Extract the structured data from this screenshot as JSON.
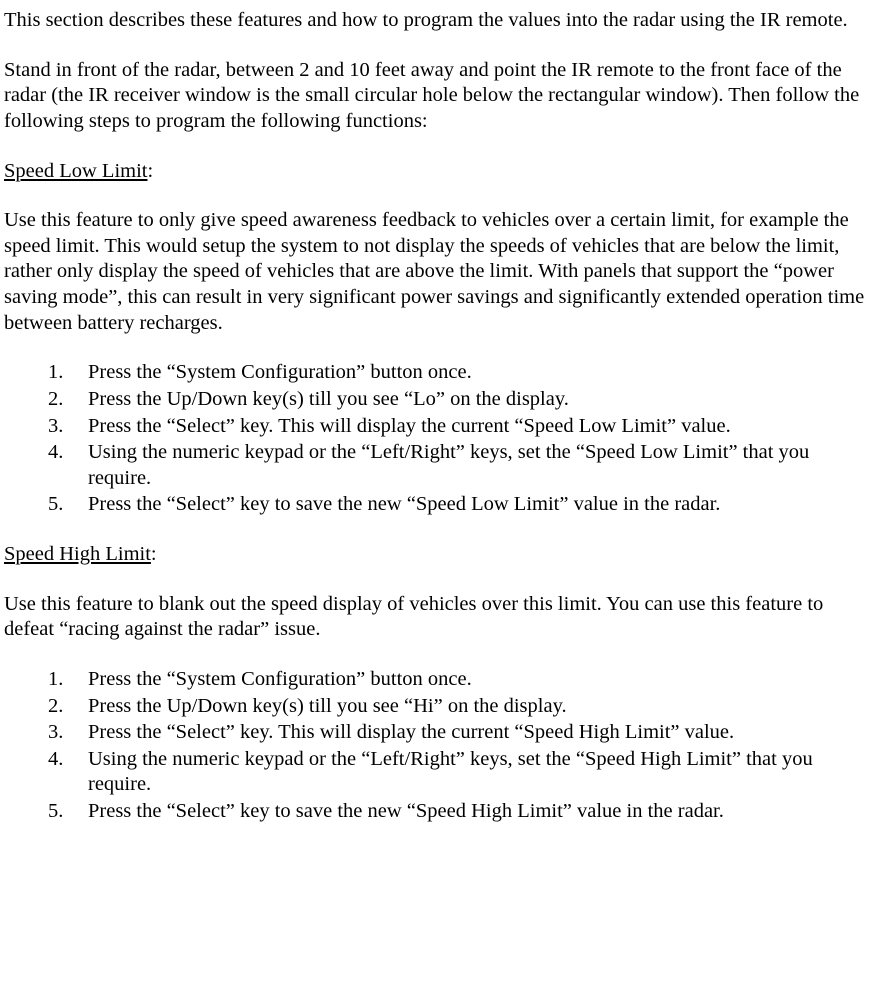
{
  "intro1": "This section describes these features and how to program the values into the radar using the IR remote.",
  "intro2": "Stand in front of the radar, between 2 and 10 feet away and point the IR remote to the front face of the radar (the IR receiver window is the small circular hole below the rectangular window). Then follow the following steps to program the following functions:",
  "speedLow": {
    "heading": "Speed Low Limit",
    "colon": ":",
    "desc": "Use this feature to only give speed awareness feedback to vehicles over a certain limit, for example the speed limit. This would setup the system to not display the speeds of vehicles that are below the limit, rather only display the speed of vehicles that are above the limit. With panels that support the “power saving mode”, this can result in very significant power savings and significantly extended operation time between battery recharges.",
    "steps": [
      "Press the “System Configuration” button once.",
      "Press the Up/Down key(s) till you see “Lo” on the display.",
      "Press the “Select” key. This will display the current “Speed Low Limit” value.",
      "Using the numeric keypad or the “Left/Right” keys, set the “Speed  Low Limit” that you require.",
      "Press the “Select” key to save the new “Speed Low Limit” value in the radar."
    ]
  },
  "speedHigh": {
    "heading": "Speed High Limit",
    "colon": ":",
    "desc": "Use this feature to blank out the speed display of vehicles over this limit. You can use this feature to defeat “racing against the radar” issue.",
    "steps": [
      "Press the “System Configuration” button once.",
      "Press the Up/Down key(s) till you see “Hi” on the display.",
      "Press the “Select” key. This will display the current “Speed High Limit” value.",
      "Using the numeric keypad or the “Left/Right” keys, set the “Speed  High Limit” that you require.",
      "Press the “Select” key to save the new “Speed High Limit” value in the radar."
    ]
  }
}
